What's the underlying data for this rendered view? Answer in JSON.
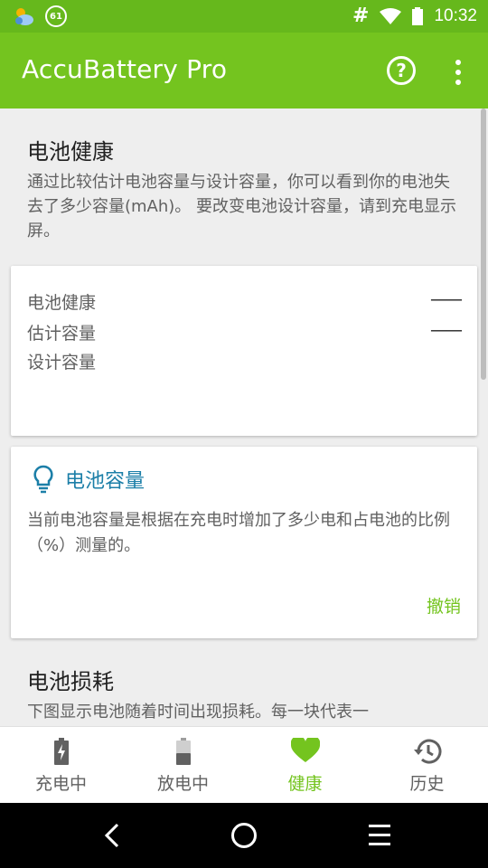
{
  "status_bar": {
    "notification_count": "61",
    "time": "10:32",
    "hash_symbol": "#"
  },
  "app_bar": {
    "title": "AccuBattery Pro",
    "help_symbol": "?"
  },
  "health_section": {
    "title": "电池健康",
    "description": "通过比较估计电池容量与设计容量，你可以看到你的电池失去了多少容量(mAh)。 要改变电池设计容量，请到充电显示屏。"
  },
  "health_card": {
    "rows": [
      {
        "label": "电池健康",
        "value": "——"
      },
      {
        "label": "估计容量",
        "value": "——"
      },
      {
        "label": "设计容量",
        "value": ""
      }
    ]
  },
  "tip_card": {
    "title": "电池容量",
    "text": "当前电池容量是根据在充电时增加了多少电和占电池的比例（%）测量的。",
    "dismiss_label": "撤销"
  },
  "wear_section": {
    "title": "电池损耗",
    "description": "下图显示电池随着时间出现损耗。每一块代表一"
  },
  "bottom_nav": {
    "items": [
      {
        "label": "充电中",
        "icon": "battery-charging-icon"
      },
      {
        "label": "放电中",
        "icon": "battery-discharging-icon"
      },
      {
        "label": "健康",
        "icon": "heart-icon"
      },
      {
        "label": "历史",
        "icon": "history-icon"
      }
    ],
    "active_index": 2
  },
  "colors": {
    "status_bar": "#66b81c",
    "app_bar": "#74c41f",
    "accent": "#74c41f",
    "tip_title": "#1c7fa8"
  }
}
